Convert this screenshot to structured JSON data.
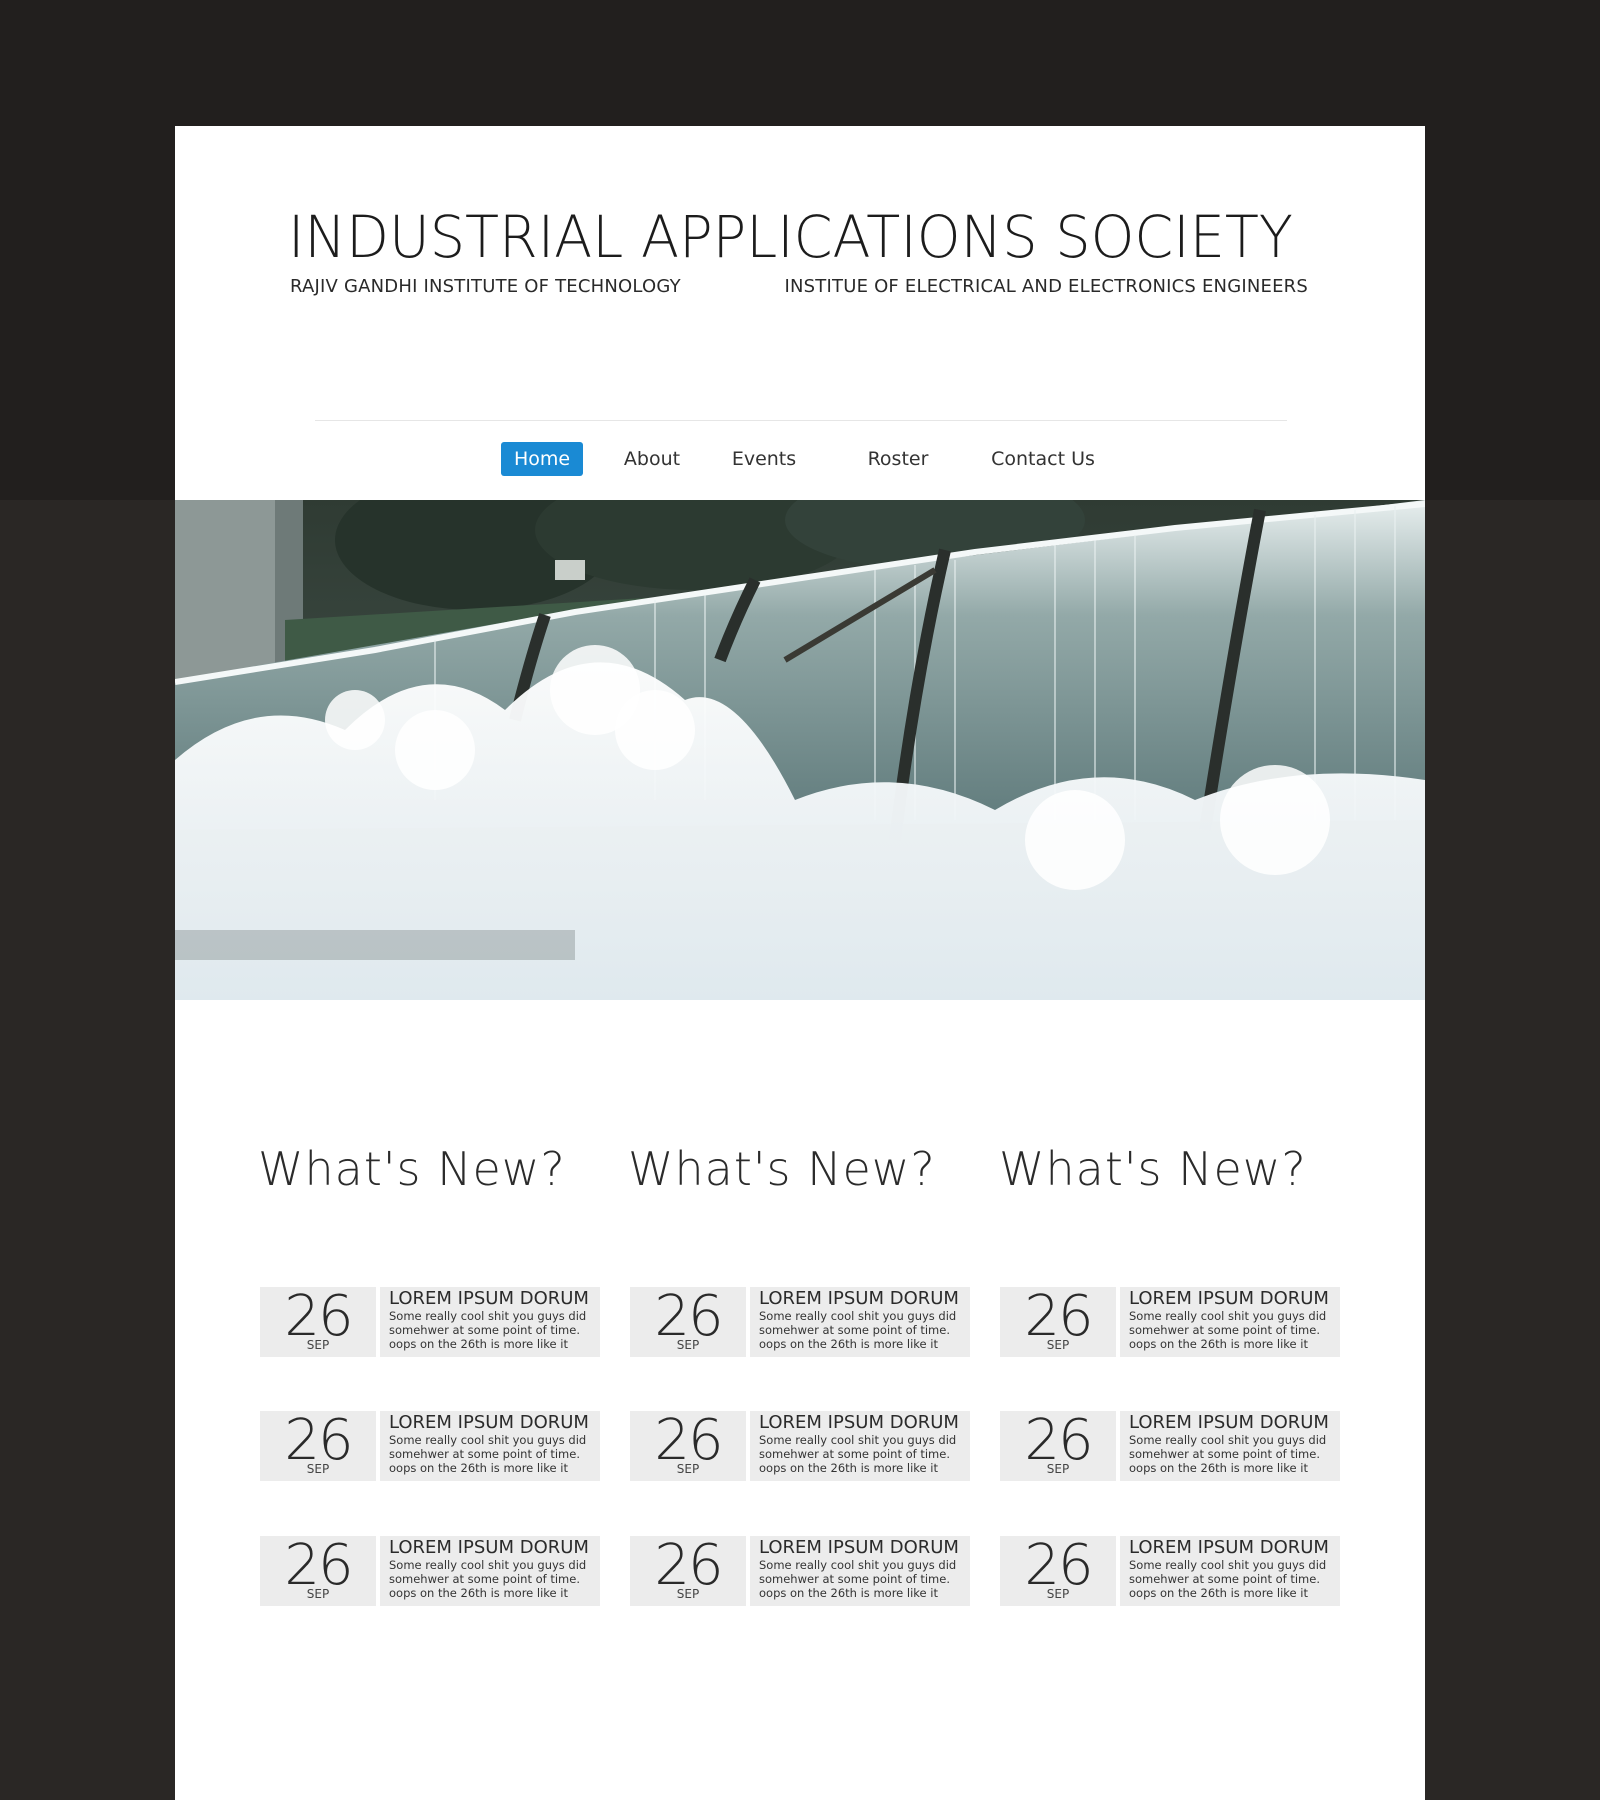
{
  "header": {
    "title": "INDUSTRIAL APPLICATIONS SOCIETY",
    "subtitle_left": "RAJIV GANDHI INSTITUTE OF TECHNOLOGY",
    "subtitle_right": "INSTITUE OF ELECTRICAL AND ELECTRONICS ENGINEERS"
  },
  "nav": {
    "items": [
      {
        "label": "Home",
        "active": true
      },
      {
        "label": "About"
      },
      {
        "label": "Events"
      },
      {
        "label": "Roster"
      },
      {
        "label": "Contact Us"
      }
    ]
  },
  "hero": {
    "image": "waterfall weir photo"
  },
  "colors": {
    "accent": "#1a8ad4",
    "background": "#2a2725",
    "card": "#ececec"
  },
  "columns": [
    {
      "title": "What's New?",
      "items": [
        {
          "day": "26",
          "month": "SEP",
          "title": "LOREM IPSUM DORUM",
          "desc": "Some really cool shit you guys did somehwer at some point of time. oops on the 26th is more like it"
        },
        {
          "day": "26",
          "month": "SEP",
          "title": "LOREM IPSUM DORUM",
          "desc": "Some really cool shit you guys did somehwer at some point of time. oops on the 26th is more like it"
        },
        {
          "day": "26",
          "month": "SEP",
          "title": "LOREM IPSUM DORUM",
          "desc": "Some really cool shit you guys did somehwer at some point of time. oops on the 26th is more like it"
        }
      ]
    },
    {
      "title": "What's New?",
      "items": [
        {
          "day": "26",
          "month": "SEP",
          "title": "LOREM IPSUM DORUM",
          "desc": "Some really cool shit you guys did somehwer at some point of time. oops on the 26th is more like it"
        },
        {
          "day": "26",
          "month": "SEP",
          "title": "LOREM IPSUM DORUM",
          "desc": "Some really cool shit you guys did somehwer at some point of time. oops on the 26th is more like it"
        },
        {
          "day": "26",
          "month": "SEP",
          "title": "LOREM IPSUM DORUM",
          "desc": "Some really cool shit you guys did somehwer at some point of time. oops on the 26th is more like it"
        }
      ]
    },
    {
      "title": "What's New?",
      "items": [
        {
          "day": "26",
          "month": "SEP",
          "title": "LOREM IPSUM DORUM",
          "desc": "Some really cool shit you guys did somehwer at some point of time. oops on the 26th is more like it"
        },
        {
          "day": "26",
          "month": "SEP",
          "title": "LOREM IPSUM DORUM",
          "desc": "Some really cool shit you guys did somehwer at some point of time. oops on the 26th is more like it"
        },
        {
          "day": "26",
          "month": "SEP",
          "title": "LOREM IPSUM DORUM",
          "desc": "Some really cool shit you guys did somehwer at some point of time. oops on the 26th is more like it"
        }
      ]
    }
  ]
}
